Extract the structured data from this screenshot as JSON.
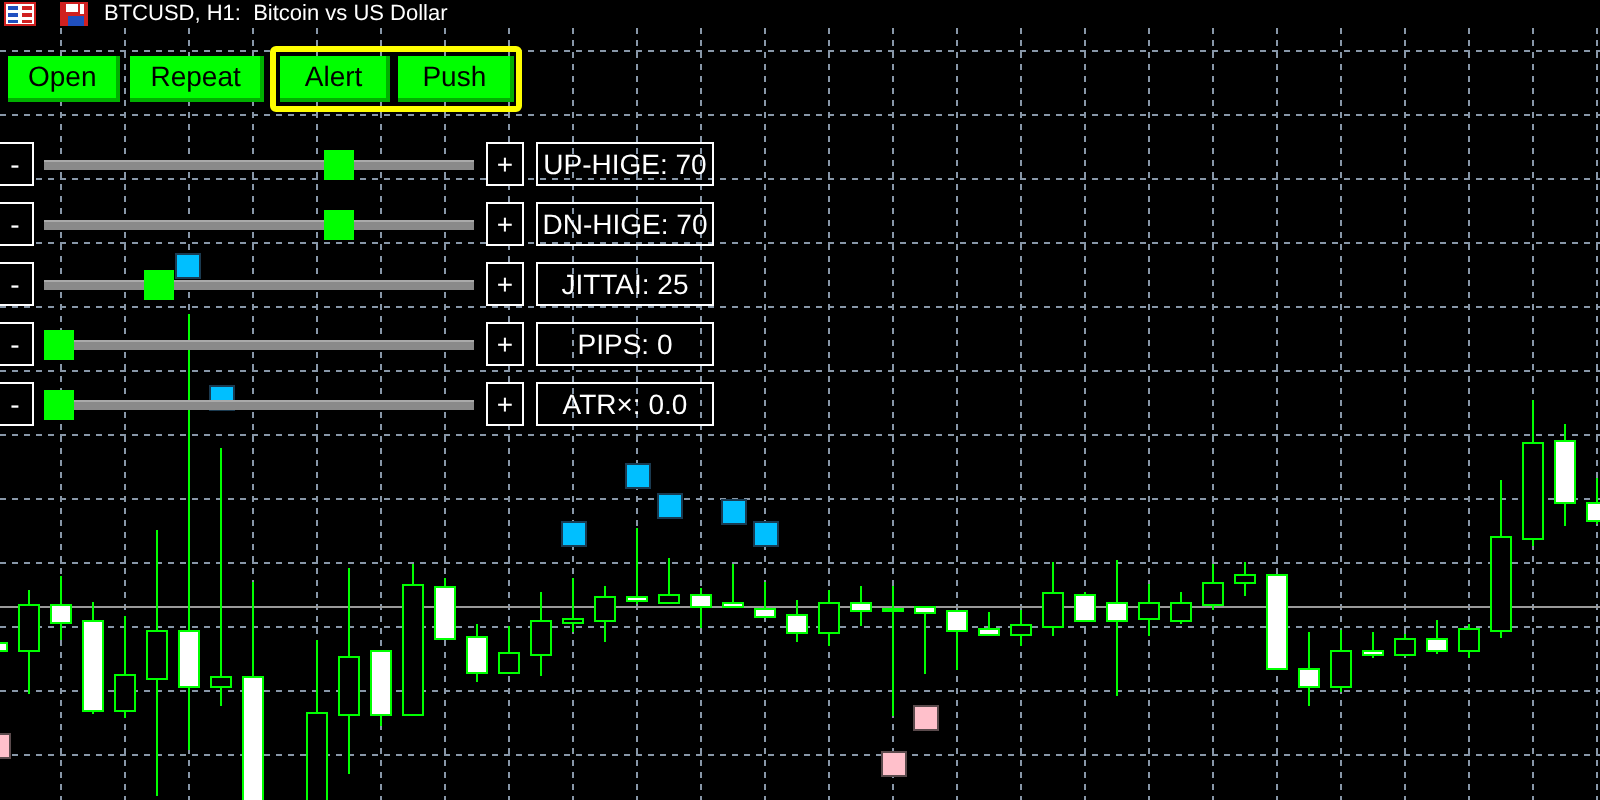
{
  "window": {
    "title": "BTCUSD, H1:  Bitcoin vs US Dollar"
  },
  "buttons": [
    {
      "label": "Open",
      "framed": false
    },
    {
      "label": "Repeat",
      "framed": false
    },
    {
      "label": "Alert",
      "framed": true
    },
    {
      "label": "Push",
      "framed": true
    }
  ],
  "sliders": [
    {
      "minus": "-",
      "plus": "+",
      "label": "UP-HIGE: 70",
      "level": 0.7
    },
    {
      "minus": "-",
      "plus": "+",
      "label": "DN-HIGE: 70",
      "level": 0.7
    },
    {
      "minus": "-",
      "plus": "+",
      "label": "JITTAI: 25",
      "level": 0.25
    },
    {
      "minus": "-",
      "plus": "+",
      "label": "PIPS: 0",
      "level": 0
    },
    {
      "minus": "-",
      "plus": "+",
      "label": "ATR×: 0.0",
      "level": 0
    }
  ]
}
